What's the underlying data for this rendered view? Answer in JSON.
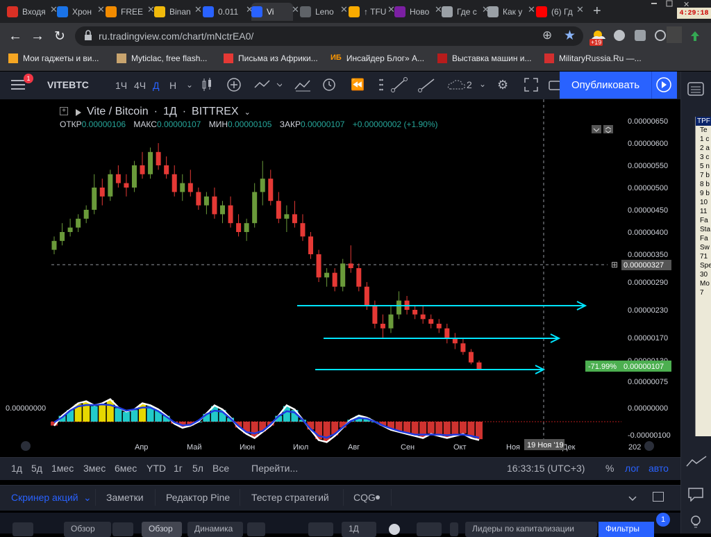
{
  "browser": {
    "tabs": [
      {
        "label": "Входя",
        "color": "#d93025"
      },
      {
        "label": "Хрон",
        "color": "#1a73e8"
      },
      {
        "label": "FREE",
        "color": "#f28b00"
      },
      {
        "label": "Binan",
        "color": "#f0b90b"
      },
      {
        "label": "0.011",
        "color": "#2962ff"
      },
      {
        "label": "Vi",
        "color": "#2962ff"
      },
      {
        "label": "Leno",
        "color": "#5f6368"
      },
      {
        "label": "↑ TFU",
        "color": "#f9ab00"
      },
      {
        "label": "Ново",
        "color": "#7b1fa2"
      },
      {
        "label": "Где с",
        "color": "#9aa0a6"
      },
      {
        "label": "Как у",
        "color": "#9aa0a6"
      },
      {
        "label": "(6) Гд",
        "color": "#ff0000"
      }
    ],
    "url": "ru.tradingview.com/chart/mNctrEA0/",
    "clock": "4:29:18",
    "badge": "+19",
    "bookmarks": [
      {
        "label": "Мои гаджеты и ви...",
        "color": "#f5a623"
      },
      {
        "label": "Myticlac, free flash...",
        "color": "#c8a46e"
      },
      {
        "label": "Письма из Африки...",
        "color": "#e53935"
      },
      {
        "label": "Инсайдер Блог» А...",
        "color": "#ff9800",
        "prefix": "ИБ"
      },
      {
        "label": "Выставка машин и...",
        "color": "#b71c1c"
      },
      {
        "label": "MilitaryRussia.Ru —...",
        "color": "#d32f2f"
      }
    ]
  },
  "toolbar": {
    "notif_count": "1",
    "symbol": "VITEBTC",
    "intervals": [
      "1Ч",
      "4Ч",
      "Д",
      "Н"
    ],
    "active_interval": "Д",
    "layout_count": "2",
    "publish_label": "Опубликовать"
  },
  "chart": {
    "title": "Vite / Bitcoin",
    "interval": "1Д",
    "exchange": "BITTREX",
    "ohlc": {
      "o_label": "ОТКР",
      "o": "0.00000106",
      "h_label": "МАКС",
      "h": "0.00000107",
      "l_label": "МИН",
      "l": "0.00000105",
      "c_label": "ЗАКР",
      "c": "0.00000107",
      "change": "+0.00000002 (+1.90%)"
    },
    "price_axis": [
      "0.00000650",
      "0.00000600",
      "0.00000550",
      "0.00000500",
      "0.00000450",
      "0.00000400",
      "0.00000350",
      "0.00000290",
      "0.00000230",
      "0.00000170",
      "0.00000130",
      "0.00000075",
      "0.00000000",
      "-0.00000100"
    ],
    "crosshair_price": "0.00000327",
    "last_price": "0.00000107",
    "last_change_pct": "-71.99%",
    "osc_label": "0.00000000",
    "time_axis": [
      "Апр",
      "Май",
      "Июн",
      "Июл",
      "Авг",
      "Сен",
      "Окт",
      "Ноя",
      "Дек",
      "202"
    ],
    "crosshair_date": "19 Ноя '19",
    "colors": {
      "up": "#6a9a3a",
      "down": "#e53935",
      "arrow": "#00e5ff",
      "macd_blue": "#1e3ae0",
      "macd_white": "#ffffff",
      "hist_red": "#e53935",
      "hist_cyan": "#26e0e0",
      "hist_yellow": "#ffee00"
    }
  },
  "chart_data": {
    "type": "candlestick",
    "title": "Vite / Bitcoin",
    "x_range": [
      "2019-03-01",
      "2019-10-14"
    ],
    "ylim": [
      3e-07,
      6.5e-06
    ],
    "candles": [
      [
        3.6,
        3.9,
        3.5,
        3.8
      ],
      [
        3.8,
        4.2,
        3.7,
        4.0
      ],
      [
        4.0,
        4.3,
        3.9,
        4.1
      ],
      [
        4.1,
        4.4,
        4.0,
        4.3
      ],
      [
        4.3,
        4.6,
        4.2,
        4.5
      ],
      [
        4.5,
        5.3,
        4.4,
        5.0
      ],
      [
        5.0,
        5.2,
        4.6,
        4.8
      ],
      [
        4.8,
        5.4,
        4.7,
        5.3
      ],
      [
        5.3,
        5.5,
        5.0,
        5.1
      ],
      [
        5.1,
        5.3,
        4.8,
        5.0
      ],
      [
        5.0,
        5.6,
        4.9,
        5.5
      ],
      [
        5.5,
        5.8,
        5.2,
        5.3
      ],
      [
        5.3,
        5.9,
        5.2,
        5.8
      ],
      [
        5.8,
        6.0,
        5.4,
        5.5
      ],
      [
        5.5,
        5.7,
        5.2,
        5.3
      ],
      [
        5.3,
        5.5,
        4.8,
        4.9
      ],
      [
        4.9,
        5.3,
        4.7,
        5.1
      ],
      [
        5.1,
        5.4,
        4.8,
        4.9
      ],
      [
        4.9,
        5.0,
        4.5,
        4.6
      ],
      [
        4.6,
        4.9,
        4.4,
        4.8
      ],
      [
        4.8,
        5.0,
        4.3,
        4.4
      ],
      [
        4.4,
        4.7,
        4.2,
        4.6
      ],
      [
        4.6,
        4.8,
        4.1,
        4.2
      ],
      [
        4.2,
        4.4,
        3.9,
        4.0
      ],
      [
        4.0,
        4.3,
        3.8,
        4.2
      ],
      [
        4.2,
        5.1,
        4.1,
        4.9
      ],
      [
        4.9,
        5.6,
        4.6,
        5.2
      ],
      [
        5.2,
        5.4,
        4.6,
        4.7
      ],
      [
        4.7,
        4.9,
        4.2,
        4.3
      ],
      [
        4.3,
        4.6,
        4.0,
        4.4
      ],
      [
        4.4,
        4.7,
        4.1,
        4.2
      ],
      [
        4.2,
        4.4,
        3.8,
        3.9
      ],
      [
        3.9,
        4.0,
        3.4,
        3.5
      ],
      [
        3.5,
        3.6,
        2.9,
        3.0
      ],
      [
        3.0,
        3.2,
        2.8,
        3.1
      ],
      [
        3.1,
        3.2,
        2.7,
        2.8
      ],
      [
        2.8,
        3.4,
        2.7,
        3.3
      ],
      [
        3.3,
        3.7,
        3.1,
        3.2
      ],
      [
        3.2,
        3.3,
        2.7,
        2.8
      ],
      [
        2.8,
        2.9,
        2.3,
        2.4
      ],
      [
        2.4,
        2.5,
        1.9,
        2.0
      ],
      [
        2.0,
        2.2,
        1.7,
        1.9
      ],
      [
        1.9,
        2.4,
        1.8,
        2.2
      ],
      [
        2.2,
        2.7,
        2.1,
        2.5
      ],
      [
        2.5,
        2.6,
        2.2,
        2.3
      ],
      [
        2.3,
        2.4,
        2.1,
        2.2
      ],
      [
        2.2,
        2.4,
        2.0,
        2.1
      ],
      [
        2.1,
        2.2,
        1.9,
        2.0
      ],
      [
        2.0,
        2.1,
        1.8,
        1.9
      ],
      [
        1.9,
        2.0,
        1.6,
        1.7
      ],
      [
        1.7,
        1.8,
        1.5,
        1.6
      ],
      [
        1.6,
        1.7,
        1.4,
        1.45
      ],
      [
        1.45,
        1.5,
        1.2,
        1.25
      ],
      [
        1.25,
        1.3,
        1.05,
        1.07
      ]
    ],
    "histogram": [
      -0.2,
      0.3,
      0.6,
      0.9,
      1.0,
      0.8,
      0.9,
      1.1,
      0.7,
      0.5,
      0.6,
      0.9,
      0.8,
      0.6,
      0.3,
      -0.1,
      -0.3,
      -0.2,
      0.0,
      0.4,
      0.8,
      0.6,
      0.2,
      -0.3,
      -0.6,
      -0.8,
      -0.5,
      -0.2,
      0.3,
      0.8,
      0.6,
      0.1,
      -0.4,
      -0.9,
      -1.0,
      -0.7,
      -0.3,
      0.1,
      0.3,
      0.2,
      0.0,
      -0.2,
      -0.4,
      -0.5,
      -0.6,
      -0.7,
      -0.8,
      -0.6,
      -0.7,
      -0.8,
      -0.7,
      -0.6,
      -0.8,
      -0.9
    ]
  },
  "bottom": {
    "ranges": [
      "1д",
      "5д",
      "1мес",
      "3мес",
      "6мес",
      "YTD",
      "1г",
      "5л",
      "Все"
    ],
    "goto": "Перейти...",
    "time": "16:33:15 (UTC+3)",
    "pct": "%",
    "log": "лог",
    "auto": "авто",
    "panels": [
      "Скринер акций",
      "Заметки",
      "Редактор Pine",
      "Тестер стратегий",
      "CQG"
    ],
    "row": [
      "Обзор",
      "Обзор",
      "Динамика",
      "1Д",
      "Лидеры по капитализации",
      "Фильтры"
    ],
    "filters_badge": "1"
  },
  "sidewin": {
    "title": "TPF",
    "lines": [
      "Te",
      "1 c",
      "2 a",
      "3 c",
      "5 n",
      "7 b",
      "8 b",
      "9 b",
      "10",
      "11",
      "Fa",
      "Sta",
      "Fa",
      "Sw",
      "71",
      "Spe",
      "30",
      "Mo",
      "7"
    ]
  }
}
